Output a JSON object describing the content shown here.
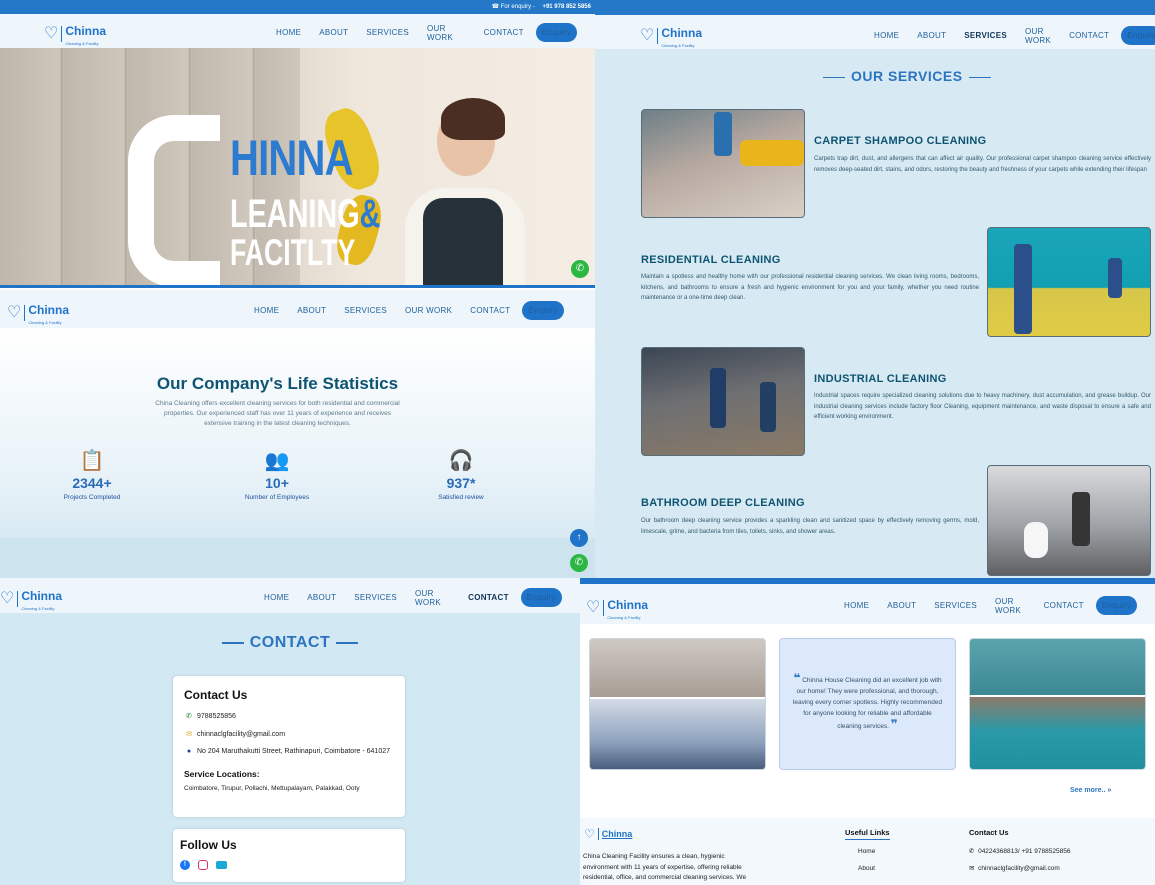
{
  "topbar": {
    "label": "For enquiry -",
    "phone": "+91 978 852 5856"
  },
  "brand": {
    "name": "Chinna",
    "tagline": "Cleaning & Facility"
  },
  "nav": {
    "home": "HOME",
    "about": "ABOUT",
    "services": "SERVICES",
    "work": "OUR WORK",
    "contact": "CONTACT",
    "enquiry": "Enquiry"
  },
  "hero": {
    "c": "C",
    "hinna": "HINNA",
    "leaning": "LEANING",
    "amp": "&",
    "facility": "FACITLTY"
  },
  "stats": {
    "title": "Our Company's Life Statistics",
    "desc": "China Cleaning offers excellent cleaning services for both residential and commercial properties. Our experienced staff has over 11 years of experience and receives extensive training in the latest cleaning techniques.",
    "items": [
      {
        "value": "2344+",
        "label": "Projects Completed",
        "icon": "clipboard-check-icon"
      },
      {
        "value": "10+",
        "label": "Number of Employees",
        "icon": "people-icon"
      },
      {
        "value": "937*",
        "label": "Satisfied review",
        "icon": "headset-icon"
      }
    ]
  },
  "services": {
    "title": "OUR SERVICES",
    "items": [
      {
        "title": "CARPET SHAMPOO CLEANING",
        "text": "Carpets trap dirt, dust, and allergens that can affect air quality. Our professional carpet shampoo cleaning service effectively removes deep-seated dirt, stains, and odors, restoring the beauty and freshness of your carpets while extending their lifespan"
      },
      {
        "title": "RESIDENTIAL CLEANING",
        "text": "Maintain a spotless and healthy home with our professional residential cleaning services. We clean living rooms, bedrooms, kitchens, and bathrooms to ensure a fresh and hygienic environment for you and your family, whether you need routine maintenance or a one-time deep clean."
      },
      {
        "title": "INDUSTRIAL CLEANING",
        "text": "Industrial spaces require specialized cleaning solutions due to heavy machinery, dust accumulation, and grease buildup. Our industrial cleaning services include factory floor Cleaning, equipment maintenance, and waste disposal to ensure a safe and efficient working environment."
      },
      {
        "title": "BATHROOM DEEP CLEANING",
        "text": "Our bathroom deep cleaning service provides a sparkling clean and sanitized space by effectively removing germs, mold, limescale, grime, and bacteria from tiles, toilets, sinks, and shower areas."
      }
    ]
  },
  "contact": {
    "title": "CONTACT",
    "card_title": "Contact Us",
    "phone": "9788525856",
    "email": "chinnaclgfacility@gmail.com",
    "address": "No 204 Maruthakutti Street, Rathinapuri, Coimbatore - 641027",
    "locations_title": "Service Locations:",
    "locations": "Coimbatore, Tirupur, Pollachi, Mettupalayam, Palakkad, Ooty",
    "follow_title": "Follow Us"
  },
  "work": {
    "testimonial": "Chinna House Cleaning did an excellent job with our home! They were professional, and thorough, leaving every corner spotless. Highly recommended for anyone looking for reliable and affordable cleaning services.",
    "see_more": "See more..",
    "see_more_arrow": "»"
  },
  "footer": {
    "about": "China Cleaning Facility ensures a clean, hygienic environment with 11 years of expertise, offering reliable residential, office, and commercial cleaning services. We",
    "useful_links_title": "Useful Links",
    "links": [
      "Home",
      "About"
    ],
    "contact_title": "Contact Us",
    "phones": "04224368813/ +91 9788525856",
    "email": "chinnaclgfacility@gmail.com"
  },
  "colors": {
    "primary": "#1f73c8",
    "heading": "#0e5472",
    "whatsapp": "#2cb742"
  }
}
